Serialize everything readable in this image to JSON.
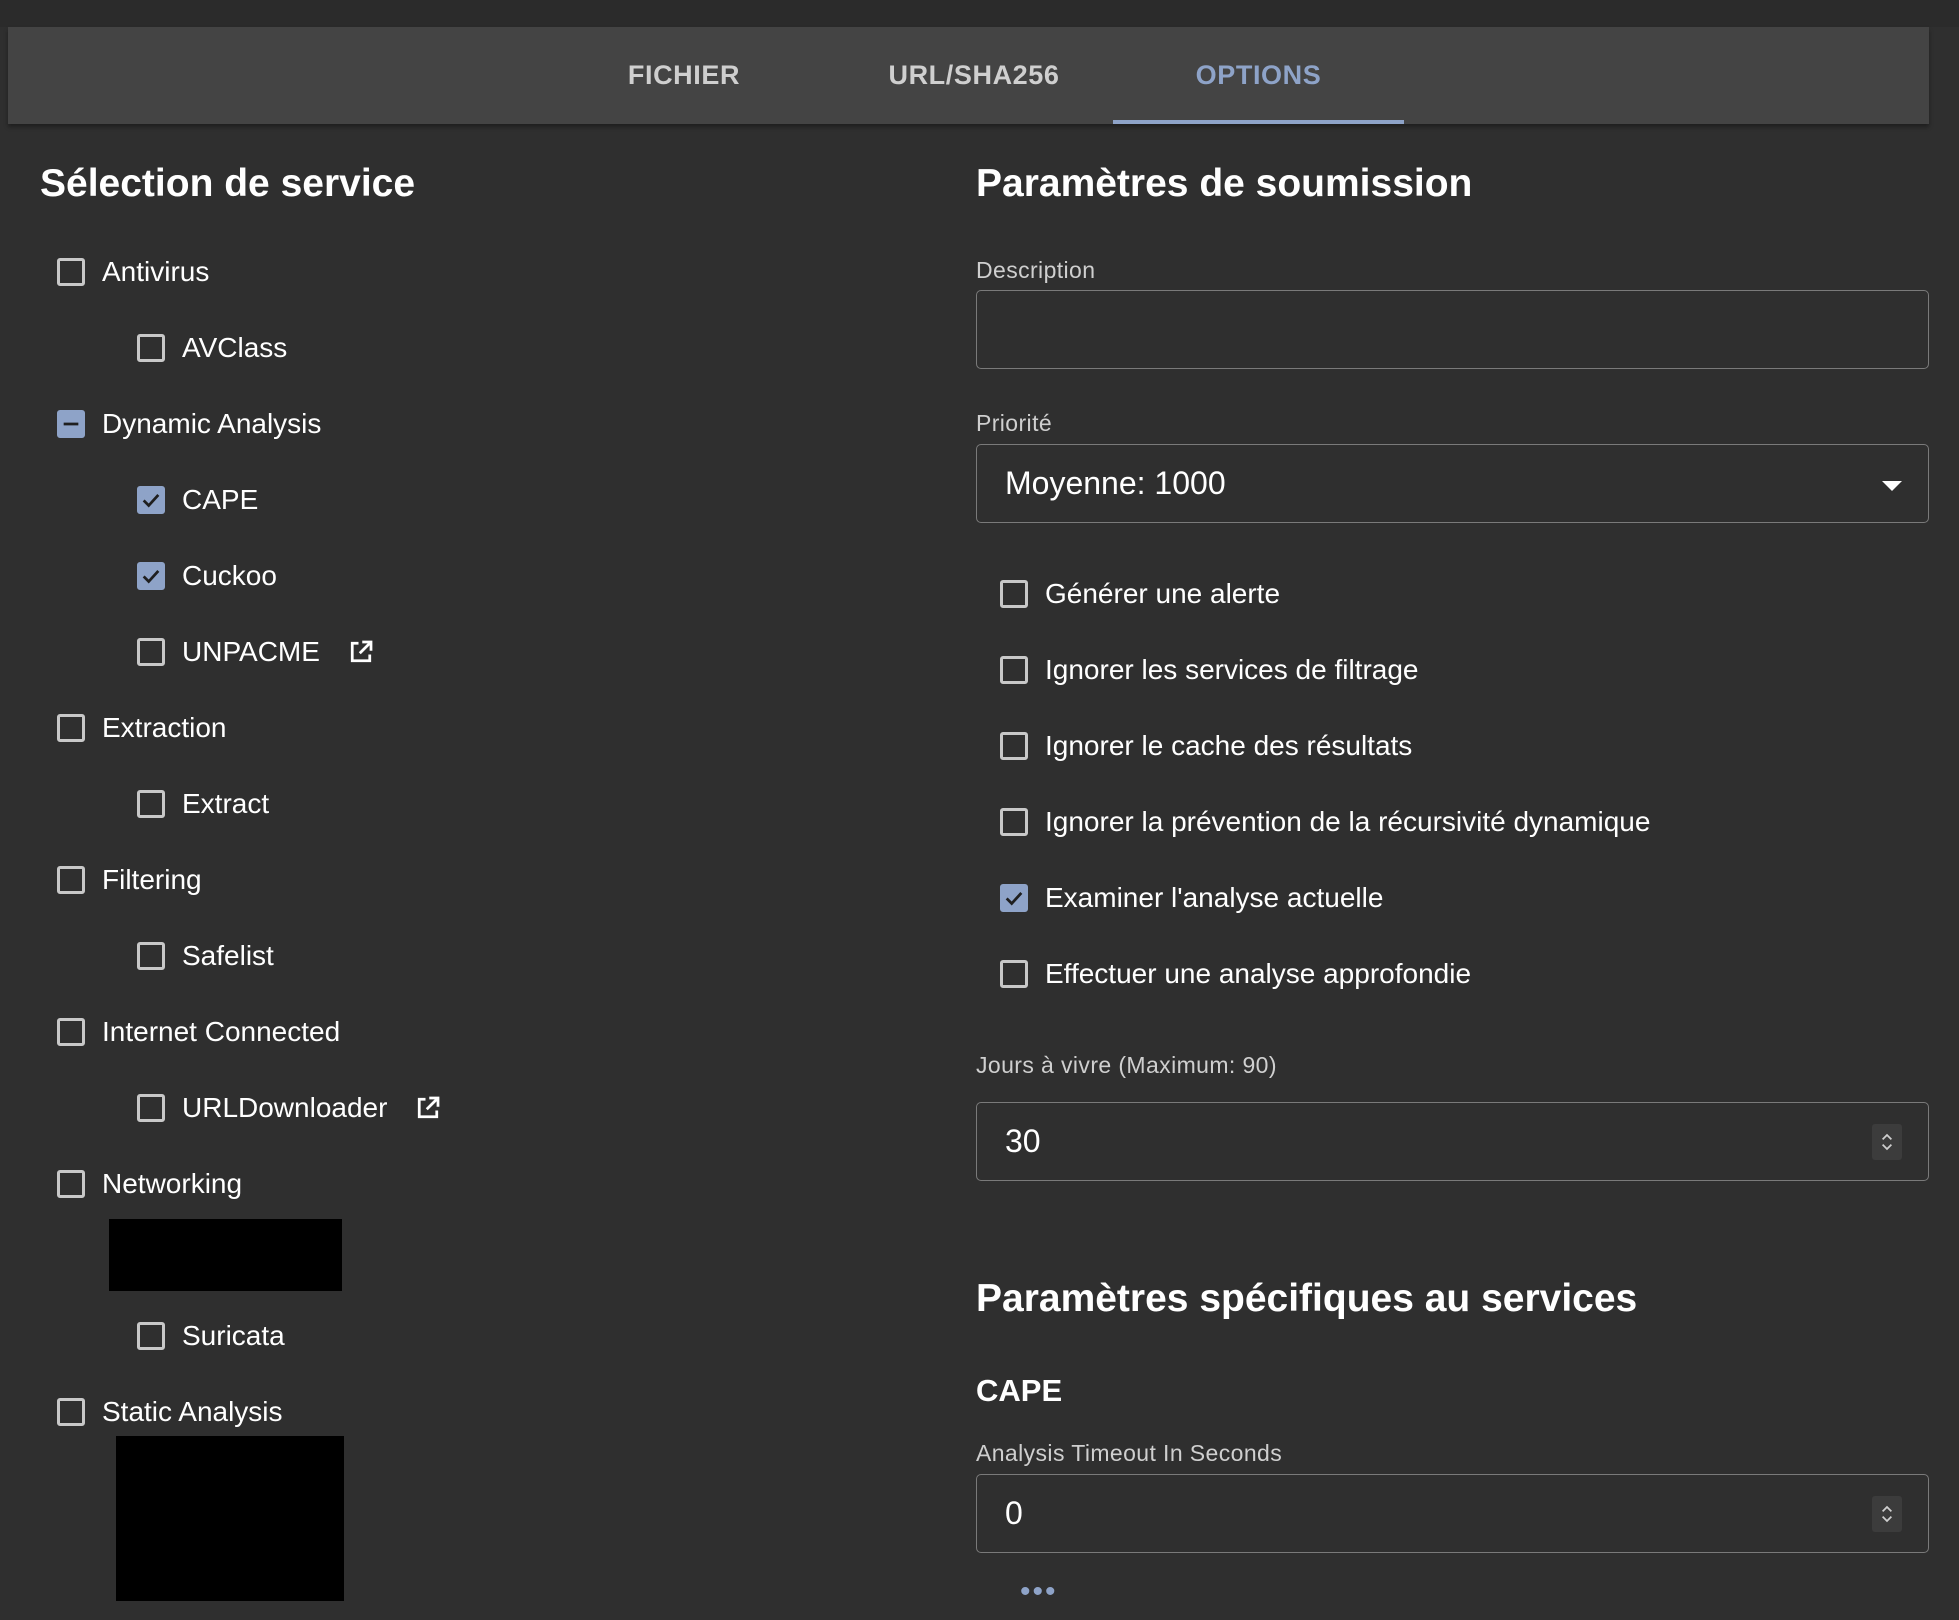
{
  "tabs": [
    {
      "label": "FICHIER",
      "active": false
    },
    {
      "label": "URL/SHA256",
      "active": false
    },
    {
      "label": "OPTIONS",
      "active": true
    }
  ],
  "service_selection": {
    "title": "Sélection de service",
    "items": [
      {
        "label": "Antivirus",
        "state": "unchecked"
      },
      {
        "label": "AVClass",
        "state": "unchecked"
      },
      {
        "label": "Dynamic Analysis",
        "state": "indeterminate"
      },
      {
        "label": "CAPE",
        "state": "checked"
      },
      {
        "label": "Cuckoo",
        "state": "checked"
      },
      {
        "label": "UNPACME",
        "state": "unchecked",
        "icon": "external-link-icon"
      },
      {
        "label": "Extraction",
        "state": "unchecked"
      },
      {
        "label": "Extract",
        "state": "unchecked"
      },
      {
        "label": "Filtering",
        "state": "unchecked"
      },
      {
        "label": "Safelist",
        "state": "unchecked"
      },
      {
        "label": "Internet Connected",
        "state": "unchecked"
      },
      {
        "label": "URLDownloader",
        "state": "unchecked",
        "icon": "external-link-icon"
      },
      {
        "label": "Networking",
        "state": "unchecked"
      },
      {
        "label": "Suricata",
        "state": "unchecked"
      },
      {
        "label": "Static Analysis",
        "state": "unchecked"
      }
    ]
  },
  "submission_params": {
    "title": "Paramètres de soumission",
    "description_label": "Description",
    "description_value": "",
    "priority_label": "Priorité",
    "priority_value": "Moyenne: 1000",
    "options": [
      {
        "label": "Générer une alerte",
        "state": "unchecked"
      },
      {
        "label": "Ignorer les services de filtrage",
        "state": "unchecked"
      },
      {
        "label": "Ignorer le cache des résultats",
        "state": "unchecked"
      },
      {
        "label": "Ignorer la prévention de la récursivité dynamique",
        "state": "unchecked"
      },
      {
        "label": "Examiner l'analyse actuelle",
        "state": "checked"
      },
      {
        "label": "Effectuer une analyse approfondie",
        "state": "unchecked"
      }
    ],
    "ttl_label": "Jours à vivre (Maximum: 90)",
    "ttl_value": "30"
  },
  "service_specific": {
    "title": "Paramètres spécifiques au services",
    "service_name": "CAPE",
    "timeout_label": "Analysis Timeout In Seconds",
    "timeout_value": "0",
    "more_label": "•••"
  },
  "colors": {
    "background": "#2f2f2f",
    "tabbar": "#444444",
    "accent": "#8ea3c8",
    "checkbox_border": "#c8c8c8"
  }
}
